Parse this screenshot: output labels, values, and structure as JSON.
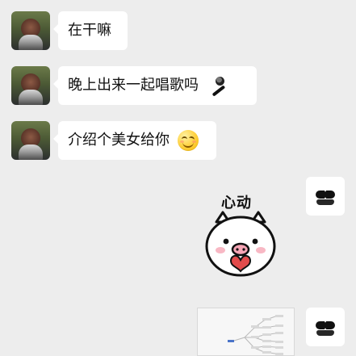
{
  "messages": [
    {
      "text": "在干嘛"
    },
    {
      "text": "晚上出来一起唱歌吗"
    },
    {
      "text": "介绍个美女给你"
    }
  ],
  "sticker": {
    "text": "心动"
  },
  "icons": {
    "left_avatar": "profile-avatar",
    "right_avatar": "sunglasses-mustache-avatar",
    "mic": "microphone-icon",
    "grin": "grinning-face-icon",
    "heart": "heart-icon",
    "pig": "pig-sticker"
  },
  "colors": {
    "background": "#ededed",
    "bubble": "#ffffff",
    "text": "#111111",
    "pig_pink": "#f7a6b6",
    "heart_red": "#e24b4b"
  }
}
